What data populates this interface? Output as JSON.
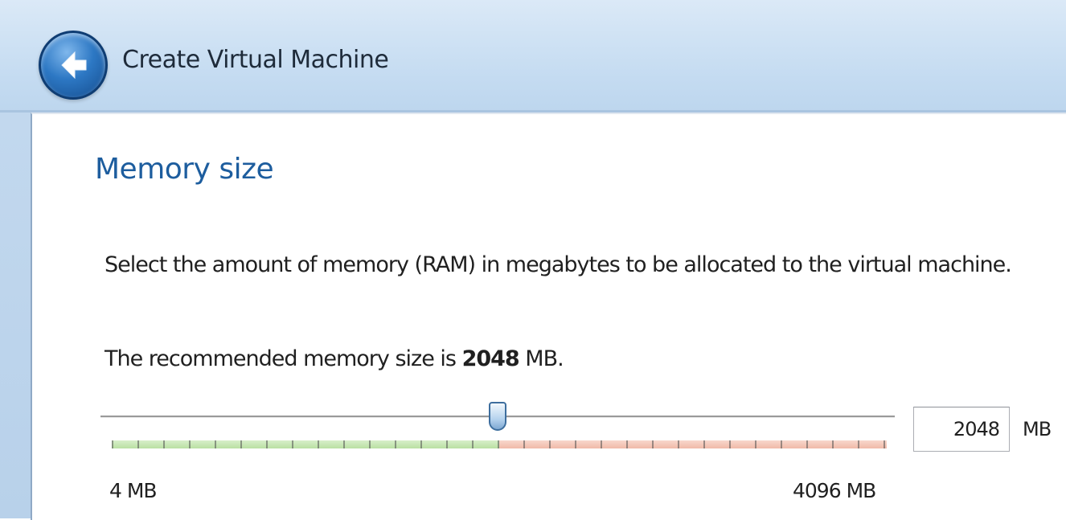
{
  "window": {
    "title": "Create Virtual Machine",
    "back_icon": "back-arrow-icon"
  },
  "page": {
    "heading": "Memory size",
    "description": "Select the amount of memory (RAM) in megabytes to be allocated to the virtual machine.",
    "recommend_prefix": "The recommended memory size is ",
    "recommend_value": "2048",
    "recommend_suffix": " MB."
  },
  "memory_slider": {
    "min_label": "4 MB",
    "max_label": "4096 MB",
    "min_value": 4,
    "max_value": 4096,
    "value": 2048,
    "recommended_value": 2048
  },
  "memory_input": {
    "value": "2048",
    "unit": "MB"
  },
  "colors": {
    "heading": "#1d5d9e",
    "safe_range": "#b9e0a3",
    "unsafe_range": "#f0b9a8"
  }
}
